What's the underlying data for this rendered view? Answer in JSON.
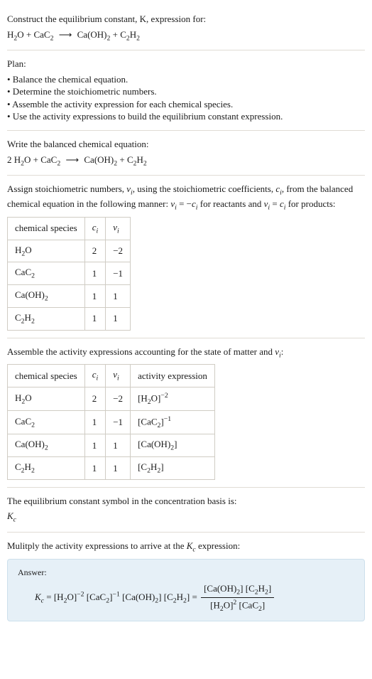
{
  "problem": {
    "prompt": "Construct the equilibrium constant, K, expression for:",
    "reaction_unbalanced_html": "H<span class='sub'>2</span>O + CaC<span class='sub'>2</span> <span class='arrow'>⟶</span> Ca(OH)<span class='sub'>2</span> + C<span class='sub'>2</span>H<span class='sub'>2</span>"
  },
  "plan": {
    "heading": "Plan:",
    "items": [
      "• Balance the chemical equation.",
      "• Determine the stoichiometric numbers.",
      "• Assemble the activity expression for each chemical species.",
      "• Use the activity expressions to build the equilibrium constant expression."
    ]
  },
  "balanced": {
    "heading": "Write the balanced chemical equation:",
    "reaction_html": "2 H<span class='sub'>2</span>O + CaC<span class='sub'>2</span> <span class='arrow'>⟶</span> Ca(OH)<span class='sub'>2</span> + C<span class='sub'>2</span>H<span class='sub'>2</span>"
  },
  "stoich": {
    "intro_html": "Assign stoichiometric numbers, <span class='italic'>ν<span class='sub'>i</span></span>, using the stoichiometric coefficients, <span class='italic'>c<span class='sub'>i</span></span>, from the balanced chemical equation in the following manner: <span class='italic'>ν<span class='sub'>i</span></span> = −<span class='italic'>c<span class='sub'>i</span></span> for reactants and <span class='italic'>ν<span class='sub'>i</span></span> = <span class='italic'>c<span class='sub'>i</span></span> for products:",
    "headers": {
      "species": "chemical species",
      "c_html": "<span class='italic'>c<span class='sub'>i</span></span>",
      "nu_html": "<span class='italic'>ν<span class='sub'>i</span></span>"
    },
    "rows": [
      {
        "species_html": "H<span class='sub'>2</span>O",
        "c": "2",
        "nu": "−2"
      },
      {
        "species_html": "CaC<span class='sub'>2</span>",
        "c": "1",
        "nu": "−1"
      },
      {
        "species_html": "Ca(OH)<span class='sub'>2</span>",
        "c": "1",
        "nu": "1"
      },
      {
        "species_html": "C<span class='sub'>2</span>H<span class='sub'>2</span>",
        "c": "1",
        "nu": "1"
      }
    ]
  },
  "activity": {
    "intro_html": "Assemble the activity expressions accounting for the state of matter and <span class='italic'>ν<span class='sub'>i</span></span>:",
    "headers": {
      "species": "chemical species",
      "c_html": "<span class='italic'>c<span class='sub'>i</span></span>",
      "nu_html": "<span class='italic'>ν<span class='sub'>i</span></span>",
      "activity": "activity expression"
    },
    "rows": [
      {
        "species_html": "H<span class='sub'>2</span>O",
        "c": "2",
        "nu": "−2",
        "act_html": "[H<span class='sub'>2</span>O]<span class='sup'>−2</span>"
      },
      {
        "species_html": "CaC<span class='sub'>2</span>",
        "c": "1",
        "nu": "−1",
        "act_html": "[CaC<span class='sub'>2</span>]<span class='sup'>−1</span>"
      },
      {
        "species_html": "Ca(OH)<span class='sub'>2</span>",
        "c": "1",
        "nu": "1",
        "act_html": "[Ca(OH)<span class='sub'>2</span>]"
      },
      {
        "species_html": "C<span class='sub'>2</span>H<span class='sub'>2</span>",
        "c": "1",
        "nu": "1",
        "act_html": "[C<span class='sub'>2</span>H<span class='sub'>2</span>]"
      }
    ]
  },
  "kc_symbol": {
    "intro": "The equilibrium constant symbol in the concentration basis is:",
    "symbol_html": "<span class='italic'>K<span class='sub'>c</span></span>"
  },
  "final": {
    "intro_html": "Mulitply the activity expressions to arrive at the <span class='italic'>K<span class='sub'>c</span></span> expression:",
    "answer_label": "Answer:",
    "lhs_html": "<span class='italic'>K<span class='sub'>c</span></span> = [H<span class='sub'>2</span>O]<span class='sup'>−2</span> [CaC<span class='sub'>2</span>]<span class='sup'>−1</span> [Ca(OH)<span class='sub'>2</span>] [C<span class='sub'>2</span>H<span class='sub'>2</span>] = ",
    "frac_num_html": "[Ca(OH)<span class='sub'>2</span>] [C<span class='sub'>2</span>H<span class='sub'>2</span>]",
    "frac_den_html": "[H<span class='sub'>2</span>O]<span class='sup'>2</span> [CaC<span class='sub'>2</span>]"
  }
}
